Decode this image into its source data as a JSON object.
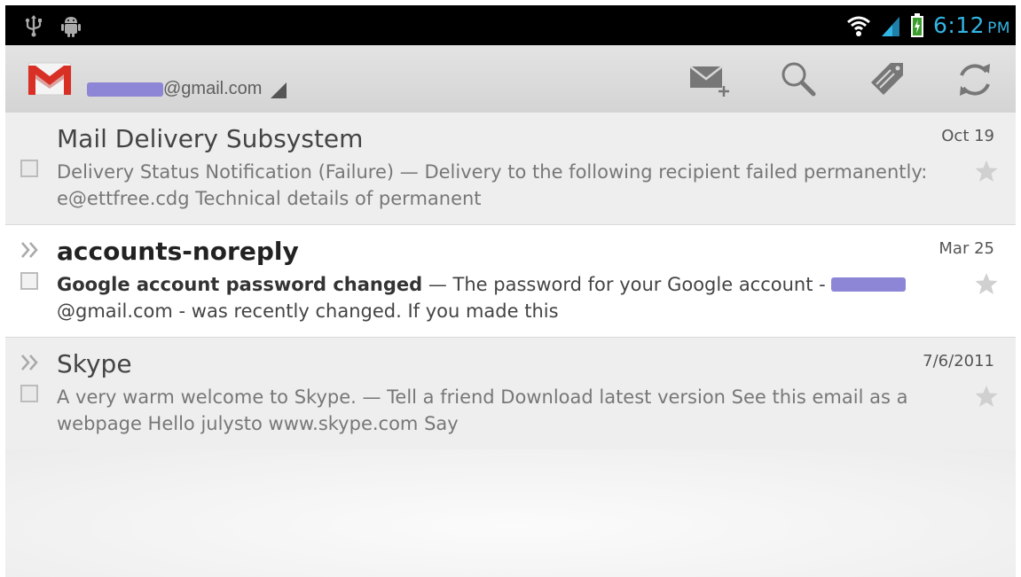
{
  "status_bar": {
    "icons": [
      "usb-icon",
      "android-debug-icon",
      "wifi-icon",
      "signal-icon",
      "battery-icon"
    ],
    "time": "6:12",
    "ampm": "PM",
    "time_color": "#33b5e5"
  },
  "action_bar": {
    "account_suffix": "@gmail.com",
    "icons": [
      "gmail-logo-icon",
      "compose-icon",
      "search-icon",
      "label-icon",
      "refresh-icon"
    ]
  },
  "messages": [
    {
      "sender": "Mail Delivery Subsystem",
      "date": "Oct 19",
      "subject": "Delivery Status Notification (Failure)",
      "snippet": " — Delivery to the following recipient failed permanently: e@ettfree.cdg Technical details of permanent",
      "unread": false,
      "important": false
    },
    {
      "sender": "accounts-noreply",
      "date": "Mar 25",
      "subject": "Google account password changed",
      "snippet_a": " — The password for your Google account - ",
      "snippet_b": "@gmail.com - was recently changed. If you made this",
      "unread": true,
      "important": true
    },
    {
      "sender": "Skype",
      "date": "7/6/2011",
      "subject": "A very warm welcome to Skype.",
      "snippet": " — Tell a friend Download latest version See this email as a webpage Hello julysto www.skype.com Say",
      "unread": false,
      "important": true
    }
  ]
}
